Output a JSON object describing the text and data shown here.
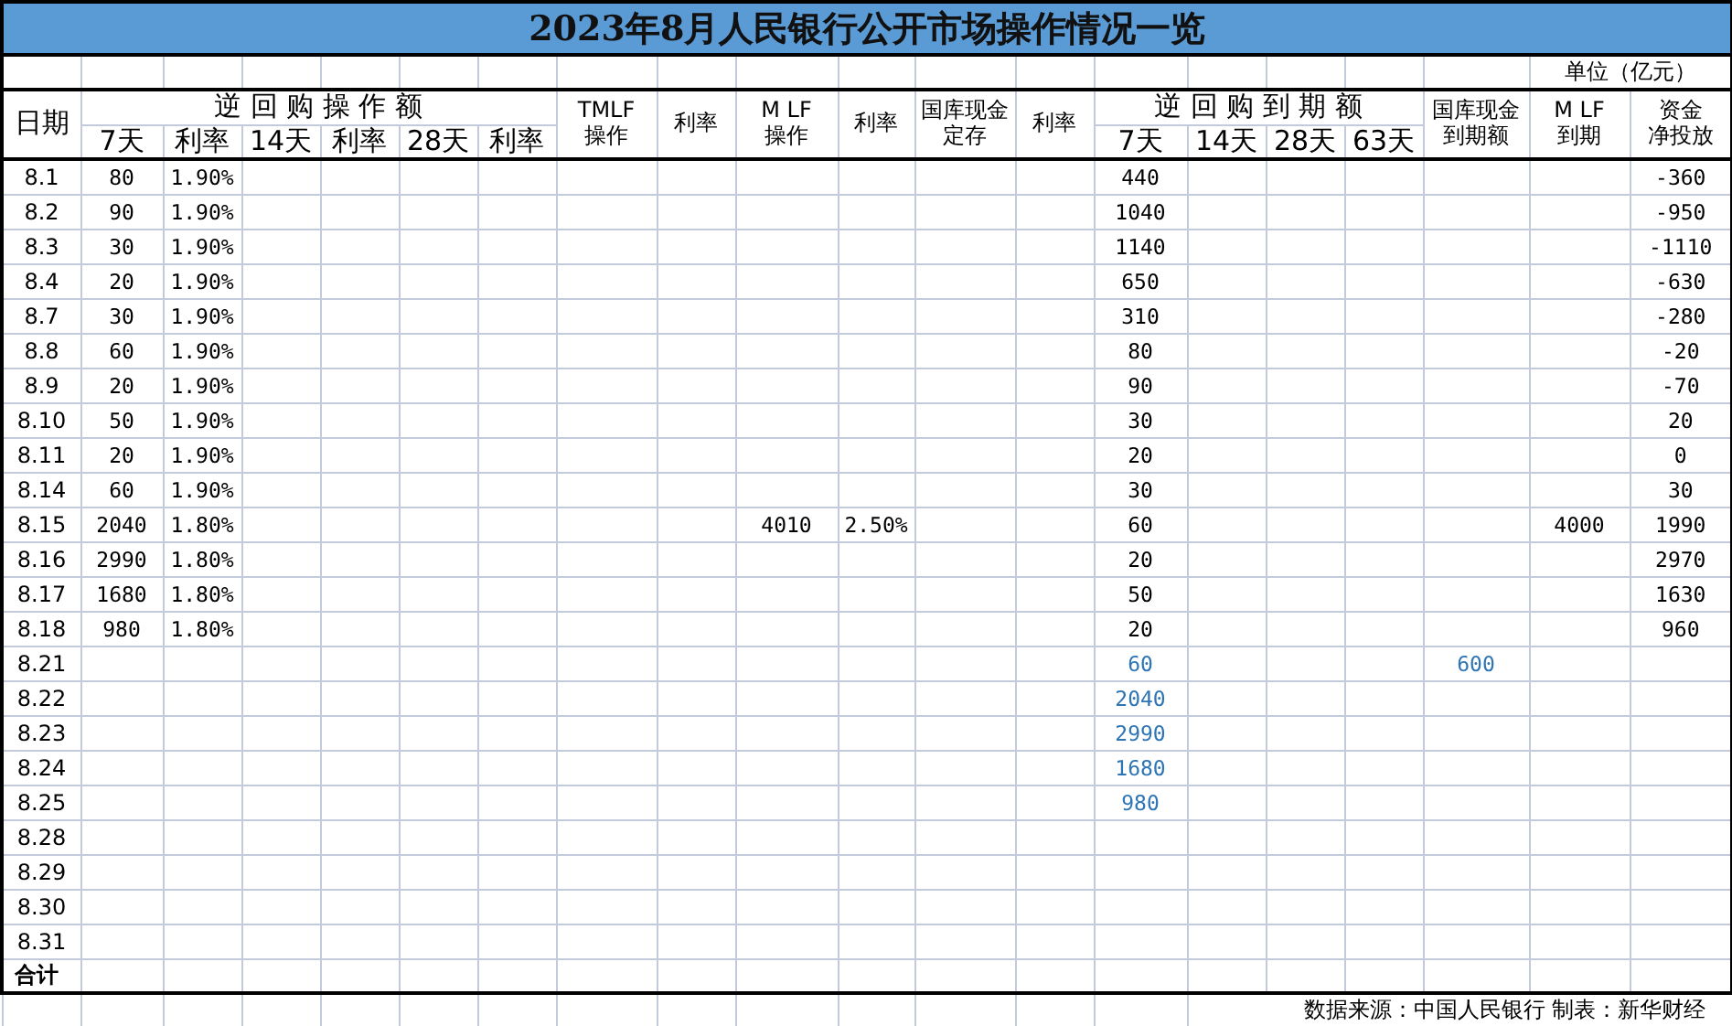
{
  "title": "2023年8月人民银行公开市场操作情况一览",
  "unit": "单位（亿元）",
  "header": {
    "date": "日期",
    "repo_ops": {
      "title": "逆 回 购 操 作 额",
      "subs": [
        "7天",
        "利率",
        "14天",
        "利率",
        "28天",
        "利率"
      ]
    },
    "tmlf": [
      "TMLF",
      "操作"
    ],
    "tmlf_rate": [
      "利率"
    ],
    "mlf": [
      "M LF",
      "操作"
    ],
    "mlf_rate": [
      "利率"
    ],
    "treasury_deposit": [
      "国库现金",
      "定存"
    ],
    "treasury_rate": [
      "利率"
    ],
    "repo_due": {
      "title": "逆 回 购 到 期 额",
      "subs": [
        "7天",
        "14天",
        "28天",
        "63天"
      ]
    },
    "treasury_due": [
      "国库现金",
      "到期额"
    ],
    "mlf_due": [
      "M LF",
      "到期"
    ],
    "net": [
      "资金",
      "净投放"
    ]
  },
  "rows": [
    {
      "kind": "day",
      "date": "8.1",
      "projected": false,
      "values": {
        "repo7": "80",
        "repo7_rate": "1.90%",
        "due7": "440",
        "net": "-360"
      }
    },
    {
      "kind": "day",
      "date": "8.2",
      "projected": false,
      "values": {
        "repo7": "90",
        "repo7_rate": "1.90%",
        "due7": "1040",
        "net": "-950"
      }
    },
    {
      "kind": "day",
      "date": "8.3",
      "projected": false,
      "values": {
        "repo7": "30",
        "repo7_rate": "1.90%",
        "due7": "1140",
        "net": "-1110"
      }
    },
    {
      "kind": "day",
      "date": "8.4",
      "projected": false,
      "values": {
        "repo7": "20",
        "repo7_rate": "1.90%",
        "due7": "650",
        "net": "-630"
      }
    },
    {
      "kind": "day",
      "date": "8.7",
      "projected": false,
      "values": {
        "repo7": "30",
        "repo7_rate": "1.90%",
        "due7": "310",
        "net": "-280"
      }
    },
    {
      "kind": "day",
      "date": "8.8",
      "projected": false,
      "values": {
        "repo7": "60",
        "repo7_rate": "1.90%",
        "due7": "80",
        "net": "-20"
      }
    },
    {
      "kind": "day",
      "date": "8.9",
      "projected": false,
      "values": {
        "repo7": "20",
        "repo7_rate": "1.90%",
        "due7": "90",
        "net": "-70"
      }
    },
    {
      "kind": "day",
      "date": "8.10",
      "projected": false,
      "values": {
        "repo7": "50",
        "repo7_rate": "1.90%",
        "due7": "30",
        "net": "20"
      }
    },
    {
      "kind": "day",
      "date": "8.11",
      "projected": false,
      "values": {
        "repo7": "20",
        "repo7_rate": "1.90%",
        "due7": "20",
        "net": "0"
      }
    },
    {
      "kind": "day",
      "date": "8.14",
      "projected": false,
      "values": {
        "repo7": "60",
        "repo7_rate": "1.90%",
        "due7": "30",
        "net": "30"
      }
    },
    {
      "kind": "day",
      "date": "8.15",
      "projected": false,
      "values": {
        "repo7": "2040",
        "repo7_rate": "1.80%",
        "mlf": "4010",
        "mlf_rate": "2.50%",
        "due7": "60",
        "mlf_due": "4000",
        "net": "1990"
      }
    },
    {
      "kind": "day",
      "date": "8.16",
      "projected": false,
      "values": {
        "repo7": "2990",
        "repo7_rate": "1.80%",
        "due7": "20",
        "net": "2970"
      }
    },
    {
      "kind": "day",
      "date": "8.17",
      "projected": false,
      "values": {
        "repo7": "1680",
        "repo7_rate": "1.80%",
        "due7": "50",
        "net": "1630"
      }
    },
    {
      "kind": "day",
      "date": "8.18",
      "projected": false,
      "values": {
        "repo7": "980",
        "repo7_rate": "1.80%",
        "due7": "20",
        "net": "960"
      }
    },
    {
      "kind": "day",
      "date": "8.21",
      "projected": true,
      "values": {
        "due7": "60",
        "treasury_due": "600"
      }
    },
    {
      "kind": "day",
      "date": "8.22",
      "projected": true,
      "values": {
        "due7": "2040"
      }
    },
    {
      "kind": "day",
      "date": "8.23",
      "projected": true,
      "values": {
        "due7": "2990"
      }
    },
    {
      "kind": "day",
      "date": "8.24",
      "projected": true,
      "values": {
        "due7": "1680"
      }
    },
    {
      "kind": "day",
      "date": "8.25",
      "projected": true,
      "values": {
        "due7": "980"
      }
    },
    {
      "kind": "day",
      "date": "8.28"
    },
    {
      "kind": "day",
      "date": "8.29"
    },
    {
      "kind": "day",
      "date": "8.30"
    },
    {
      "kind": "day",
      "date": "8.31"
    },
    {
      "kind": "total",
      "date": "合计"
    }
  ],
  "footer": "数据来源：中国人民银行  制表：新华财经"
}
